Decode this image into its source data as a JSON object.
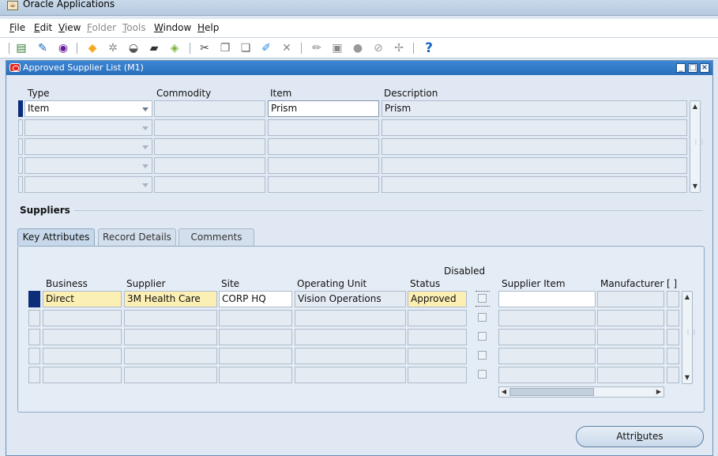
{
  "app": {
    "title": "Oracle Applications"
  },
  "menu": [
    {
      "label": "File",
      "underline": "F",
      "rest": "ile",
      "enabled": true
    },
    {
      "label": "Edit",
      "underline": "E",
      "rest": "dit",
      "enabled": true
    },
    {
      "label": "View",
      "underline": "V",
      "rest": "iew",
      "enabled": true
    },
    {
      "label": "Folder",
      "underline": "F",
      "rest": "older",
      "enabled": false
    },
    {
      "label": "Tools",
      "underline": "T",
      "rest": "ools",
      "enabled": false
    },
    {
      "label": "Window",
      "underline": "W",
      "rest": "indow",
      "enabled": true
    },
    {
      "label": "Help",
      "underline": "H",
      "rest": "elp",
      "enabled": true
    }
  ],
  "toolbar": {
    "icons": [
      "new-record-icon",
      "find-icon",
      "navigator-icon",
      "save-icon",
      "next-step-icon",
      "print-icon",
      "close-form-icon",
      "cut-icon",
      "copy-icon",
      "paste-icon",
      "new-icon",
      "clear-record-icon",
      "edit-field-icon",
      "zoom-icon",
      "translations-icon",
      "attachments-icon",
      "folder-tools-icon",
      "help-icon"
    ],
    "help_glyph": "?"
  },
  "form": {
    "title": "Approved Supplier List (M1)",
    "top_headers": {
      "type": "Type",
      "commodity": "Commodity",
      "item": "Item",
      "description": "Description"
    },
    "top_rows": [
      {
        "type": "Item",
        "commodity": "",
        "item": "Prism",
        "description": "Prism"
      },
      {
        "type": "",
        "commodity": "",
        "item": "",
        "description": ""
      },
      {
        "type": "",
        "commodity": "",
        "item": "",
        "description": ""
      },
      {
        "type": "",
        "commodity": "",
        "item": "",
        "description": ""
      },
      {
        "type": "",
        "commodity": "",
        "item": "",
        "description": ""
      }
    ],
    "suppliers_section": "Suppliers",
    "tabs": [
      {
        "label": "Key Attributes",
        "active": true
      },
      {
        "label": "Record Details",
        "active": false
      },
      {
        "label": "Comments",
        "active": false
      }
    ],
    "supplier_headers": {
      "business": "Business",
      "supplier": "Supplier",
      "site": "Site",
      "operating_unit": "Operating Unit",
      "status": "Status",
      "disabled": "Disabled",
      "supplier_item": "Supplier Item",
      "manufacturer": "Manufacturer",
      "flex": "[ ]"
    },
    "supplier_rows": [
      {
        "business": "Direct",
        "supplier": "3M Health Care",
        "site": "CORP HQ",
        "operating_unit": "Vision Operations",
        "status": "Approved",
        "disabled": false,
        "supplier_item": "",
        "manufacturer": ""
      },
      {
        "business": "",
        "supplier": "",
        "site": "",
        "operating_unit": "",
        "status": "",
        "disabled": false,
        "supplier_item": "",
        "manufacturer": ""
      },
      {
        "business": "",
        "supplier": "",
        "site": "",
        "operating_unit": "",
        "status": "",
        "disabled": false,
        "supplier_item": "",
        "manufacturer": ""
      },
      {
        "business": "",
        "supplier": "",
        "site": "",
        "operating_unit": "",
        "status": "",
        "disabled": false,
        "supplier_item": "",
        "manufacturer": ""
      },
      {
        "business": "",
        "supplier": "",
        "site": "",
        "operating_unit": "",
        "status": "",
        "disabled": false,
        "supplier_item": "",
        "manufacturer": ""
      }
    ],
    "attributes_button": {
      "label": "Attributes",
      "pre": "Attri",
      "underline": "b",
      "post": "utes"
    }
  },
  "colors": {
    "current_record": "#0b2d7a",
    "required_field": "#fcefb4",
    "title_bar": "#2a6fbd"
  }
}
